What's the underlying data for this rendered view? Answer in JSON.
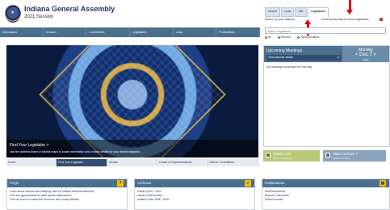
{
  "header": {
    "title": "Indiana General Assembly",
    "session": "2021 Session",
    "subtabs": [
      "Search",
      "Code",
      "Site",
      "Legislators"
    ],
    "search_label": "Search by your address",
    "download_link": "Download full list of current legislators"
  },
  "nav": {
    "items": [
      "Information",
      "Session",
      "Committees",
      "Legislators",
      "Laws",
      "Publications"
    ]
  },
  "search": {
    "placeholder": "Search Legislators",
    "radios": [
      "All",
      "Senators",
      "Representatives"
    ]
  },
  "hero": {
    "title": "Find Your Legislator  >",
    "text": "Use the address finder or district maps to locate information and contact details for your district legislator."
  },
  "meetings": {
    "title": "Upcoming Meetings",
    "calendar_link": "View calendar details",
    "day": "Monday",
    "date": "< Dec 7 >",
    "year": "2020",
    "no_meetings_text": "No meetings scheduled for this day."
  },
  "promos": [
    {
      "title": "Watch Live",
      "sub": "Session Schedule"
    },
    {
      "title": "Video Archive >",
      "sub": "Session Archive"
    }
  ],
  "subnav": {
    "items": [
      "Home",
      "Find Your Legislator",
      "Senate",
      "House of Representatives",
      "Interim Committees"
    ]
  },
  "panels": {
    "faq": {
      "title": "FAQs",
      "icon": "?",
      "links": [
        "Learn about session and lobbying rules for Indiana General Assembly.",
        "How are appointments to state panels determined?",
        "Find out how to contact the Governor and county officials."
      ]
    },
    "archives": {
      "title": "Archives",
      "icon": "≡",
      "links": [
        "Interim 2009 - 2019",
        "Interim 2008 Archive",
        "Indiana Code 2008 - 2009"
      ]
    },
    "publications": {
      "title": "Publications",
      "icon": "▤",
      "links": [
        "Acts/Resolutions",
        "Reports / Fiscal Info",
        "Rules/Journals"
      ]
    }
  }
}
